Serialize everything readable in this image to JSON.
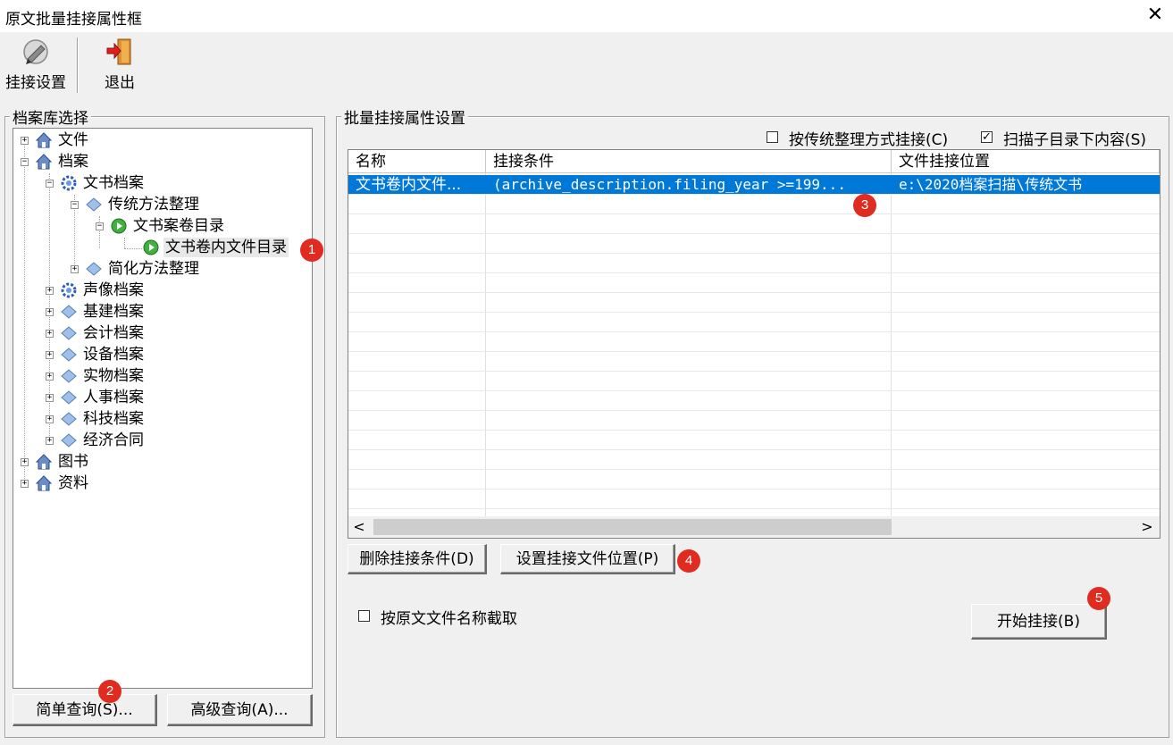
{
  "window": {
    "title": "原文批量挂接属性框",
    "close_symbol": "✕"
  },
  "toolbar": {
    "settings_label": "挂接设置",
    "exit_label": "退出"
  },
  "left_panel": {
    "title": "档案库选择",
    "tree": [
      {
        "label": "文件",
        "icon": "house-icon",
        "toggle": "+"
      },
      {
        "label": "档案",
        "icon": "house-icon",
        "toggle": "−"
      },
      {
        "label": "文书档案",
        "icon": "gear-icon",
        "toggle": "−"
      },
      {
        "label": "传统方法整理",
        "icon": "diamond-icon",
        "toggle": "−"
      },
      {
        "label": "文书案卷目录",
        "icon": "play-icon",
        "toggle": "−"
      },
      {
        "label": "文书卷内文件目录",
        "icon": "play-icon",
        "toggle": ""
      },
      {
        "label": "简化方法整理",
        "icon": "diamond-icon",
        "toggle": "+"
      },
      {
        "label": "声像档案",
        "icon": "gear-icon",
        "toggle": "+"
      },
      {
        "label": "基建档案",
        "icon": "diamond-icon",
        "toggle": "+"
      },
      {
        "label": "会计档案",
        "icon": "diamond-icon",
        "toggle": "+"
      },
      {
        "label": "设备档案",
        "icon": "diamond-icon",
        "toggle": "+"
      },
      {
        "label": "实物档案",
        "icon": "diamond-icon",
        "toggle": "+"
      },
      {
        "label": "人事档案",
        "icon": "diamond-icon",
        "toggle": "+"
      },
      {
        "label": "科技档案",
        "icon": "diamond-icon",
        "toggle": "+"
      },
      {
        "label": "经济合同",
        "icon": "diamond-icon",
        "toggle": "+"
      },
      {
        "label": "图书",
        "icon": "house-icon",
        "toggle": "+"
      },
      {
        "label": "资料",
        "icon": "house-icon",
        "toggle": "+"
      }
    ],
    "simple_query": "简单查询(S)...",
    "advanced_query": "高级查询(A)..."
  },
  "right_panel": {
    "title": "批量挂接属性设置",
    "traditional_checkbox": {
      "label": "按传统整理方式挂接(C)",
      "checked": false
    },
    "scan_subdir_checkbox": {
      "label": "扫描子目录下内容(S)",
      "checked": true
    },
    "grid": {
      "columns": [
        "名称",
        "挂接条件",
        "文件挂接位置"
      ],
      "rows": [
        [
          "文书卷内文件...",
          "(archive_description.filing_year >=199...",
          "e:\\2020档案扫描\\传统文书"
        ]
      ]
    },
    "scroll_left": "<",
    "scroll_right": ">",
    "delete_button": "删除挂接条件(D)",
    "set_location_button": "设置挂接文件位置(P)",
    "truncate_checkbox": {
      "label": "按原文文件名称截取",
      "checked": false
    },
    "start_button": "开始挂接(B)"
  },
  "badges": [
    "1",
    "2",
    "3",
    "4",
    "5"
  ],
  "colors": {
    "selection": "#0078d7",
    "badge": "#e02b20"
  }
}
